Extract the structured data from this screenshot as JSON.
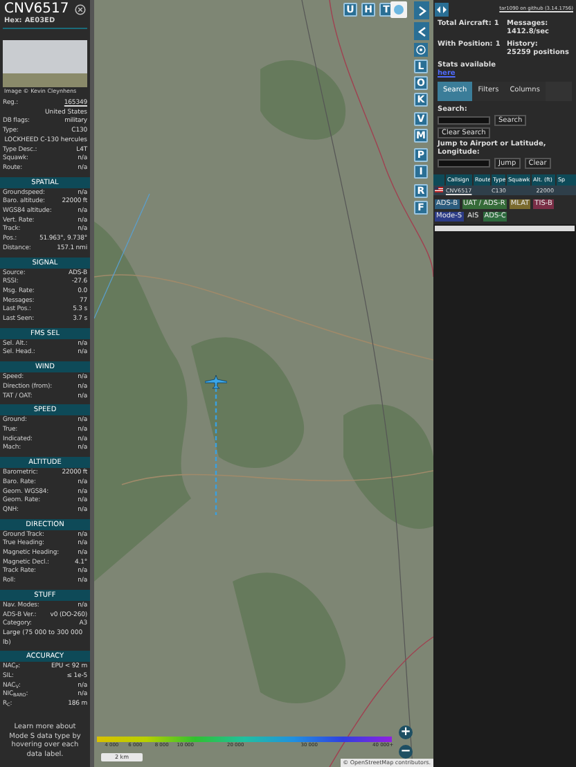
{
  "aircraft_panel": {
    "callsign": "CNV6517",
    "hex_label": "Hex:",
    "hex": "AE03ED",
    "photo_credit": "Image © Kevin Cleynhens",
    "header_rows": [
      {
        "kind": "link_pair",
        "label": "Reg.:",
        "value": "165349"
      },
      {
        "kind": "value",
        "value": "United States"
      },
      {
        "kind": "pair",
        "label": "DB flags:",
        "value": "military"
      },
      {
        "kind": "pair",
        "label": "Type:",
        "value": "C130"
      },
      {
        "kind": "value",
        "value": "LOCKHEED C-130 hercules"
      },
      {
        "kind": "pair",
        "label": "Type Desc.:",
        "value": "L4T"
      },
      {
        "kind": "pair",
        "label": "Squawk:",
        "value": "n/a"
      },
      {
        "kind": "pair",
        "label": "Route:",
        "value": "n/a"
      }
    ],
    "sections": [
      {
        "heading": "SPATIAL",
        "rows": [
          {
            "kind": "pair",
            "label": "Groundspeed:",
            "value": "n/a"
          },
          {
            "kind": "pair",
            "label": "Baro. altitude:",
            "value": "22000 ft"
          },
          {
            "kind": "pair",
            "label": "WGS84 altitude:",
            "value": "n/a"
          },
          {
            "kind": "pair",
            "label": "Vert. Rate:",
            "value": "n/a"
          },
          {
            "kind": "pair",
            "label": "Track:",
            "value": "n/a"
          },
          {
            "kind": "pair",
            "label": "Pos.:",
            "value": "51.963°, 9.738°"
          },
          {
            "kind": "pair",
            "label": "Distance:",
            "value": "157.1 nmi"
          }
        ]
      },
      {
        "heading": "SIGNAL",
        "rows": [
          {
            "kind": "pair",
            "label": "Source:",
            "value": "ADS-B"
          },
          {
            "kind": "pair",
            "label": "RSSI:",
            "value": "-27.6"
          },
          {
            "kind": "pair",
            "label": "Msg. Rate:",
            "value": "0.0"
          },
          {
            "kind": "pair",
            "label": "Messages:",
            "value": "77"
          },
          {
            "kind": "pair",
            "label": "Last Pos.:",
            "value": "5.3 s"
          },
          {
            "kind": "pair",
            "label": "Last Seen:",
            "value": "3.7 s"
          }
        ]
      },
      {
        "heading": "FMS SEL",
        "rows": [
          {
            "kind": "pair",
            "label": "Sel. Alt.:",
            "value": "n/a"
          },
          {
            "kind": "pair",
            "label": "Sel. Head.:",
            "value": "n/a"
          }
        ]
      },
      {
        "heading": "WIND",
        "rows": [
          {
            "kind": "pair",
            "label": "Speed:",
            "value": "n/a"
          },
          {
            "kind": "pair",
            "label": "Direction (from):",
            "value": "n/a"
          },
          {
            "kind": "pair",
            "label": "TAT / OAT:",
            "value": "n/a"
          }
        ]
      },
      {
        "heading": "SPEED",
        "rows": [
          {
            "kind": "pair",
            "label": "Ground:",
            "value": "n/a"
          },
          {
            "kind": "pair",
            "label": "True:",
            "value": "n/a"
          },
          {
            "kind": "pair",
            "label": "Indicated:",
            "value": "n/a"
          },
          {
            "kind": "pair",
            "label": "Mach:",
            "value": "n/a"
          }
        ]
      },
      {
        "heading": "ALTITUDE",
        "rows": [
          {
            "kind": "pair",
            "label": "Barometric:",
            "value": "22000 ft"
          },
          {
            "kind": "pair",
            "label": "Baro. Rate:",
            "value": "n/a"
          },
          {
            "kind": "pair",
            "label": "Geom. WGS84:",
            "value": "n/a"
          },
          {
            "kind": "pair",
            "label": "Geom. Rate:",
            "value": "n/a"
          },
          {
            "kind": "pair",
            "label": "QNH:",
            "value": "n/a"
          }
        ]
      },
      {
        "heading": "DIRECTION",
        "rows": [
          {
            "kind": "pair",
            "label": "Ground Track:",
            "value": "n/a"
          },
          {
            "kind": "pair",
            "label": "True Heading:",
            "value": "n/a"
          },
          {
            "kind": "pair",
            "label": "Magnetic Heading:",
            "value": "n/a"
          },
          {
            "kind": "pair",
            "label": "Magnetic Decl.:",
            "value": "4.1°"
          },
          {
            "kind": "pair",
            "label": "Track Rate:",
            "value": "n/a"
          },
          {
            "kind": "pair",
            "label": "Roll:",
            "value": "n/a"
          }
        ]
      },
      {
        "heading": "STUFF",
        "rows": [
          {
            "kind": "pair",
            "label": "Nav. Modes:",
            "value": "n/a"
          },
          {
            "kind": "pair",
            "label": "ADS-B Ver.:",
            "value": "v0 (DO-260)"
          },
          {
            "kind": "pair",
            "label": "Category:",
            "value": "A3"
          },
          {
            "kind": "note",
            "label": "Large (75 000 to 300 000 lb)"
          }
        ]
      },
      {
        "heading": "ACCURACY",
        "rows": [
          {
            "kind": "pair",
            "label": "NAC$_{P}$:",
            "value": "EPU < 92 m"
          },
          {
            "kind": "pair",
            "label": "SIL:",
            "value": "≤ 1e-5"
          },
          {
            "kind": "pair",
            "label": "NAC$_{V}$:",
            "value": "n/a"
          },
          {
            "kind": "pair",
            "label": "NIC$_{BARO}$:",
            "value": "n/a"
          },
          {
            "kind": "pair",
            "label": "R$_{C}$:",
            "value": "186 m"
          }
        ]
      }
    ],
    "footer": "Learn more about Mode S data type by hovering over each data label."
  },
  "map": {
    "top_buttons": [
      "U",
      "H",
      "T"
    ],
    "side_buttons": [
      "L",
      "O",
      "K",
      "V",
      "M",
      "P",
      "I",
      "R",
      "F"
    ],
    "altitude_scale": [
      "4 000",
      "6 000",
      "8 000",
      "10 000",
      "20 000",
      "30 000",
      "40 000+"
    ],
    "scale_bar": "2 km",
    "zoom_in": "+",
    "zoom_out": "−",
    "attribution_prefix": "© ",
    "attribution_link": "OpenStreetMap",
    "attribution_suffix": " contributors."
  },
  "side_panel": {
    "version_link": "tar1090 on github (3.14.1756)",
    "stats": [
      {
        "label": "Total Aircraft:",
        "value": "1"
      },
      {
        "label": "Messages:",
        "value": "1412.8/sec"
      },
      {
        "label": "With Position:",
        "value": "1"
      },
      {
        "label": "History:",
        "value": "25259 positions"
      }
    ],
    "stats_text": "Stats available",
    "stats_link": "here",
    "tabs": [
      {
        "label": "Search",
        "selected": true
      },
      {
        "label": "Filters",
        "selected": false
      },
      {
        "label": "Columns",
        "selected": false
      }
    ],
    "search_label": "Search:",
    "search_button": "Search",
    "clear_search_button": "Clear Search",
    "jump_label": "Jump to Airport or Latitude, Longitude:",
    "jump_button": "Jump",
    "clear_button": "Clear",
    "table": {
      "columns": [
        "Callsign",
        "Route",
        "Type",
        "Squawk",
        "Alt. (ft)",
        "Sp"
      ],
      "rows": [
        {
          "callsign": "CNV6517",
          "type": "C130",
          "altitude": "22000"
        }
      ]
    },
    "legend": [
      {
        "label": "ADS-B",
        "color": "#2b5c7e"
      },
      {
        "label": "UAT / ADS-R",
        "color": "#356b38"
      },
      {
        "label": "MLAT",
        "color": "#7a6a2e"
      },
      {
        "label": "TIS-B",
        "color": "#7a2e46"
      },
      {
        "label": "Mode-S",
        "color": "#2c3b86"
      },
      {
        "label": "AIS",
        "color": "#2e2e2e"
      },
      {
        "label": "ADS-C",
        "color": "#2e6b3e"
      }
    ]
  }
}
